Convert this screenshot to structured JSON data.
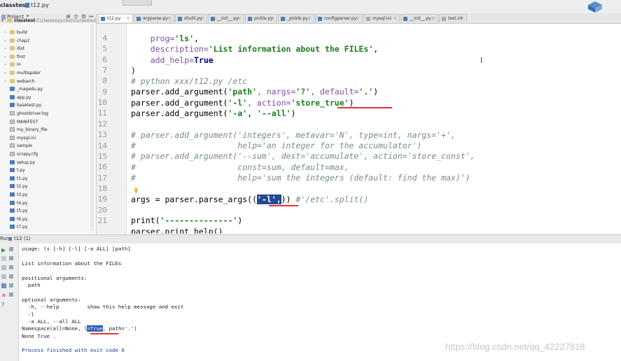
{
  "breadcrumb": {
    "project": "classtest",
    "file": "t12.py"
  },
  "project_panel": {
    "title": "Project",
    "root": {
      "name": "classtest",
      "path": "F:\\classes\\pycharm\\classtest"
    },
    "items": [
      {
        "name": "build",
        "type": "folder"
      },
      {
        "name": "chap2",
        "type": "folder"
      },
      {
        "name": "dist",
        "type": "folder"
      },
      {
        "name": "first",
        "type": "folder"
      },
      {
        "name": "m",
        "type": "folder"
      },
      {
        "name": "multispider",
        "type": "folder"
      },
      {
        "name": "webarch",
        "type": "folder"
      },
      {
        "name": "_magedu.py",
        "type": "py"
      },
      {
        "name": "app.py",
        "type": "py"
      },
      {
        "name": "basetest.py",
        "type": "py"
      },
      {
        "name": "ghostdriver.log",
        "type": "file"
      },
      {
        "name": "MANIFEST",
        "type": "file"
      },
      {
        "name": "my_binary_file",
        "type": "file"
      },
      {
        "name": "mysql.ini",
        "type": "file"
      },
      {
        "name": "sample",
        "type": "file"
      },
      {
        "name": "scrapy.cfg",
        "type": "file"
      },
      {
        "name": "setup.py",
        "type": "py"
      },
      {
        "name": "t.py",
        "type": "py"
      },
      {
        "name": "t1.py",
        "type": "py"
      },
      {
        "name": "t2.py",
        "type": "py"
      },
      {
        "name": "t3.py",
        "type": "py"
      },
      {
        "name": "t4.py",
        "type": "py"
      },
      {
        "name": "t5.py",
        "type": "py"
      },
      {
        "name": "t6.py",
        "type": "py"
      },
      {
        "name": "t7.py",
        "type": "py"
      }
    ]
  },
  "tabs": [
    {
      "label": "t12.py",
      "active": true,
      "type": "py"
    },
    {
      "label": "argparse.py",
      "type": "py"
    },
    {
      "label": "shutil.py",
      "type": "py"
    },
    {
      "label": "__init__.py",
      "type": "py"
    },
    {
      "label": "pickle.py",
      "type": "py"
    },
    {
      "label": "_pickle.py",
      "type": "py"
    },
    {
      "label": "configparser.py",
      "type": "py"
    },
    {
      "label": "mysql.ini",
      "type": "file"
    },
    {
      "label": "__init__.py",
      "type": "py"
    },
    {
      "label": "test.ini",
      "type": "file"
    }
  ],
  "editor": {
    "line_numbers": [
      "4",
      "5",
      "6",
      "7",
      "8",
      "9",
      "10",
      "11",
      "12",
      "13",
      "14",
      "15",
      "16",
      "17",
      "18",
      "19",
      "20",
      "21"
    ],
    "lines": {
      "l4": [
        "    prog=",
        "'ls'",
        ","
      ],
      "l5": [
        "    description=",
        "'List information about the FILEs'",
        ","
      ],
      "l6": [
        "    add_help=",
        "True"
      ],
      "l7": [
        ")"
      ],
      "l8": [
        "# python xxx/t12.py /etc"
      ],
      "l9": [
        "parser.add_argument(",
        "'path'",
        ", nargs=",
        "'?'",
        ", default=",
        "'.'",
        ")"
      ],
      "l10": [
        "parser.add_argument(",
        "'-l'",
        ", action=",
        "'store_true'",
        ")"
      ],
      "l11": [
        "parser.add_argument(",
        "'-a'",
        ", ",
        "'--all'",
        ")"
      ],
      "l13": [
        "# parser.add_argument('integers', metavar='N', type=int, nargs='+',"
      ],
      "l14": [
        "#                     help='an integer for the accumulator')"
      ],
      "l15": [
        "# parser.add_argument('--sum', dest='accumulate', action='store_const',"
      ],
      "l16": [
        "#                     const=sum, default=max,"
      ],
      "l17": [
        "#                     help='sum the integers (default: find the max)')"
      ],
      "l19": [
        "args = parser.parse_args((",
        "'-l',",
        ")) ",
        "#'/etc'.split()"
      ],
      "l20": [
        "print(",
        "'--------------'",
        ")"
      ],
      "l21": [
        "parser.print_help()"
      ]
    }
  },
  "run_panel": {
    "title": "Run",
    "config": "t12 (1)",
    "output": {
      "usage": "usage: ls [-h] [-l] [-a ALL] [path]",
      "description": "List information about the FILEs",
      "positional_header": "positional arguments:",
      "positional_path": "  path",
      "optional_header": "optional arguments:",
      "opt_help": "  -h, --help         show this help message and exit",
      "opt_l": "  -l",
      "opt_a": "  -a ALL, --all ALL",
      "namespace_pre": "Namespace(all=None, l",
      "namespace_sel": "=True",
      "namespace_post": ", path='.')",
      "none_true": "None True .",
      "finished": "Process finished with exit code 0"
    }
  },
  "watermark": "https://blog.csdn.net/qq_42227818",
  "colors": {
    "selection": "#234a94",
    "underline": "#e23232",
    "string": "#1c7c1c",
    "keyword": "#000080"
  }
}
